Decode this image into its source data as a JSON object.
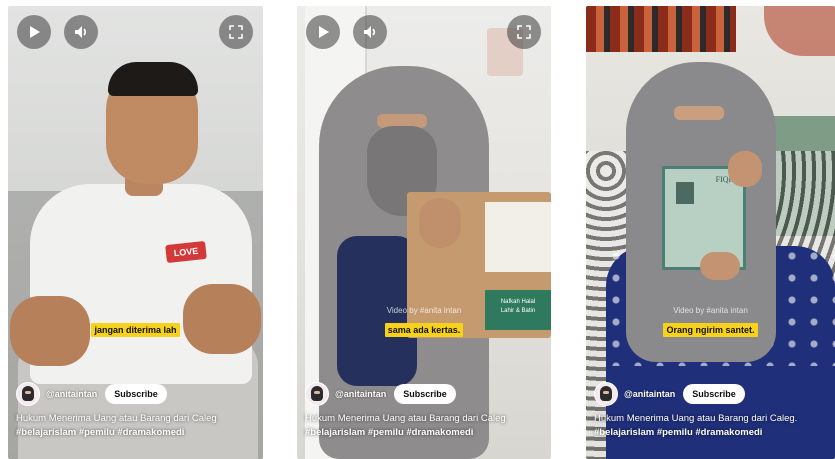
{
  "videos": [
    {
      "caption": "jangan diterima lah",
      "watermark": "",
      "channel": "@anitaintan",
      "subscribe_label": "Subscribe",
      "title": "Hukum Menerima Uang atau Barang dari Caleg",
      "hashtags": "#belajarislam #pemilu #dramakomedi"
    },
    {
      "caption": "sama ada kertas.",
      "watermark": "Video by #anita intan",
      "channel": "@anitaintan",
      "subscribe_label": "Subscribe",
      "title": "Hukum Menerima Uang atau Barang dari Caleg",
      "hashtags": "#belajarislam #pemilu #dramakomedi"
    },
    {
      "caption": "Orang ngirim santet.",
      "watermark": "Video by #anita intan",
      "channel": "@anitaintan",
      "subscribe_label": "Subscribe",
      "title": "Hukum Menerima Uang atau Barang dari Caleg.",
      "hashtags": "#belajarislam #pemilu #dramakomedi"
    }
  ],
  "box_text": {
    "line1": "Nafkah Halal",
    "line2": "Lahir & Batin"
  },
  "book_text": "FIQIH",
  "shirt_text": "LOVE",
  "icons": {
    "play": "play-icon",
    "volume": "volume-icon",
    "fullscreen": "fullscreen-icon"
  },
  "colors": {
    "caption_bg": "#f7d21d",
    "subscribe_bg": "#ffffff",
    "control_bg": "#3c3c3c"
  }
}
